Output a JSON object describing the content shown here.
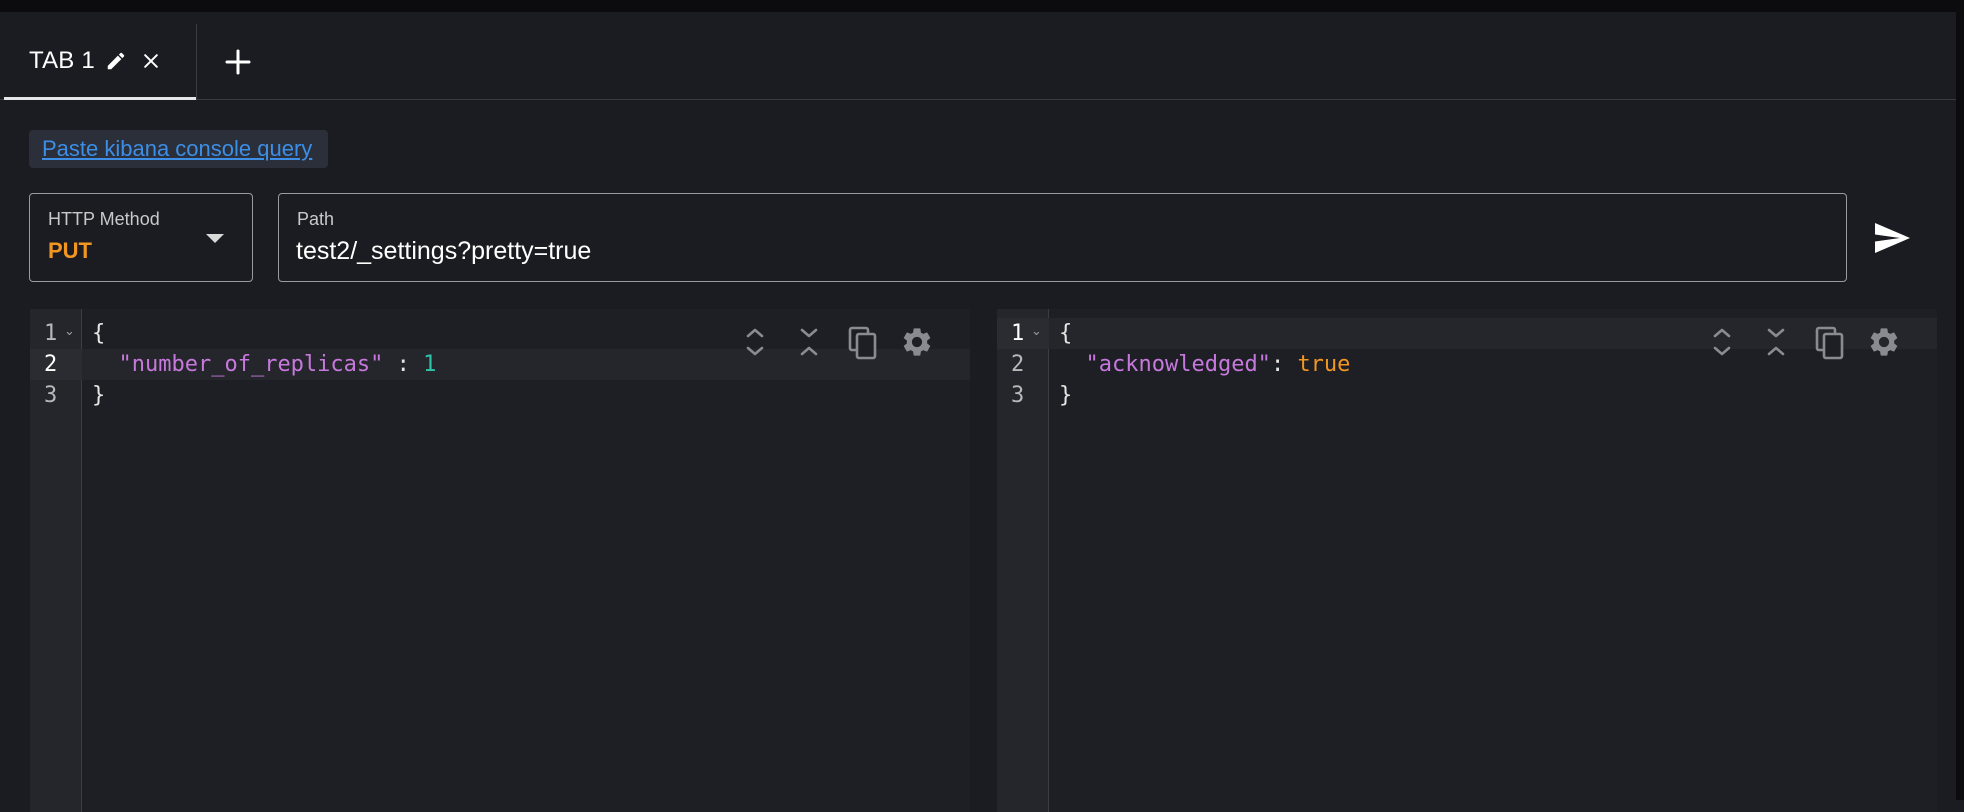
{
  "tabs": [
    {
      "label": "TAB 1",
      "active": true
    }
  ],
  "icons": {
    "tab_edit": "pencil-icon",
    "tab_close": "close-icon",
    "add_tab": "plus-icon",
    "send": "send-icon",
    "expand_all": "unfold-more-icon",
    "collapse_all": "unfold-less-icon",
    "copy": "copy-icon",
    "settings": "gear-icon"
  },
  "paste_link": "Paste kibana console query",
  "method": {
    "label": "HTTP Method",
    "value": "PUT",
    "color": "#f29622"
  },
  "path": {
    "label": "Path",
    "value": "test2/_settings?pretty=true"
  },
  "request_editor": {
    "lines": [
      {
        "number": "1",
        "open": "{"
      },
      {
        "number": "2",
        "key": "\"number_of_replicas\"",
        "sep": " : ",
        "value": "1"
      },
      {
        "number": "3",
        "close": "}"
      }
    ]
  },
  "response_editor": {
    "lines": [
      {
        "number": "1",
        "open": "{"
      },
      {
        "number": "2",
        "key": "\"acknowledged\"",
        "sep": ": ",
        "value": "true"
      },
      {
        "number": "3",
        "close": "}"
      }
    ]
  },
  "colors": {
    "background": "#1b1c21",
    "link": "#3d8ee6",
    "json_key": "#c678dd",
    "json_number": "#2ec4a8",
    "json_boolean": "#f29622"
  }
}
